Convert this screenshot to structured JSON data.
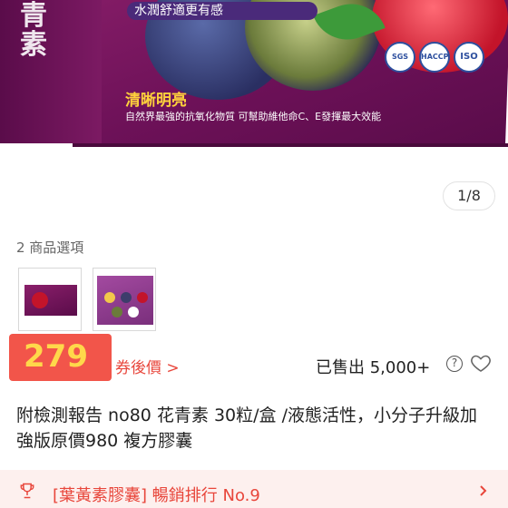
{
  "image": {
    "banner_text": "水潤舒適更有感",
    "headline": "清晰明亮",
    "subline": "自然界最強的抗氧化物質 可幫助維他命C、E發揮最大效能",
    "badges": [
      "SGS",
      "HACCP",
      "ISO"
    ],
    "side_text": "青素",
    "counter": "1/8"
  },
  "options": {
    "label": "2 商品選項",
    "thumbnails": [
      "option-1",
      "option-2"
    ]
  },
  "price": {
    "value": "279",
    "coupon_label": "券後價 >",
    "sold_label": "已售出 5,000+",
    "help_glyph": "?"
  },
  "product": {
    "title": "附檢測報告 no80 花青素 30粒/盒 /液態活性，小分子升級加強版原價980 複方膠囊"
  },
  "ranking": {
    "text": "[葉黃素膠囊] 暢銷排行 No.9"
  },
  "colors": {
    "accent": "#e8463b",
    "price_bg": "#f2554a",
    "price_text": "#ffd84a",
    "rank_bg": "#fdf0ee"
  }
}
